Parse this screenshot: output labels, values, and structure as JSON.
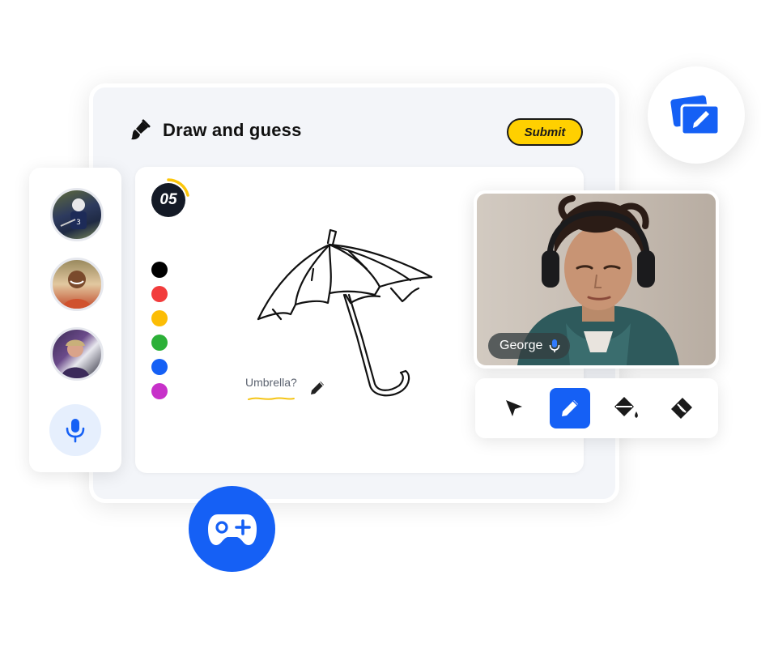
{
  "app": {
    "title": "Draw and guess",
    "submit_label": "Submit"
  },
  "canvas": {
    "timer": "05",
    "timer_progress": 0.2,
    "guess_text": "Umbrella?",
    "palette": [
      {
        "name": "black",
        "color": "#000000"
      },
      {
        "name": "red",
        "color": "#f23c3c"
      },
      {
        "name": "yellow",
        "color": "#fcbd05"
      },
      {
        "name": "green",
        "color": "#2cb038"
      },
      {
        "name": "blue",
        "color": "#1560f5"
      },
      {
        "name": "purple",
        "color": "#c731c9"
      }
    ],
    "drawing": "umbrella"
  },
  "players": {
    "avatars": [
      "player-1",
      "player-2",
      "player-3"
    ],
    "mic_icon": "microphone-icon"
  },
  "video": {
    "participant_name": "George",
    "mic_icon": "microphone-icon"
  },
  "tools": {
    "items": [
      "cursor-icon",
      "pencil-icon",
      "paint-bucket-icon",
      "eraser-icon"
    ],
    "active": "pencil-icon"
  },
  "colors": {
    "accent": "#1560f5",
    "submit": "#ffd000",
    "panel_bg": "#f3f5f9"
  }
}
